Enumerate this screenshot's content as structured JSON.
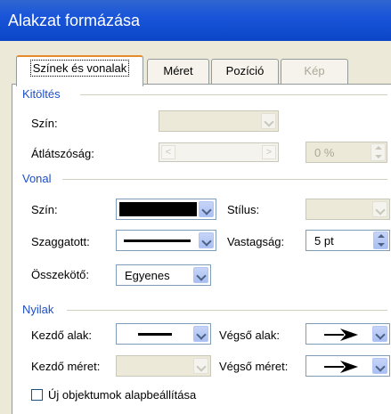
{
  "window": {
    "title": "Alakzat formázása"
  },
  "tabs": [
    {
      "label": "Színek és vonalak",
      "state": "active"
    },
    {
      "label": "Méret",
      "state": "normal"
    },
    {
      "label": "Pozíció",
      "state": "normal"
    },
    {
      "label": "Kép",
      "state": "disabled"
    }
  ],
  "fill": {
    "section_label": "Kitöltés",
    "color_label": "Szín:",
    "transparency_label": "Átlátszóság:",
    "transparency_value": "0 %"
  },
  "line": {
    "section_label": "Vonal",
    "color_label": "Szín:",
    "style_label": "Stílus:",
    "dash_label": "Szaggatott:",
    "weight_label": "Vastagság:",
    "weight_value": "5 pt",
    "connector_label": "Összekötő:",
    "connector_value": "Egyenes"
  },
  "arrows": {
    "section_label": "Nyilak",
    "begin_style_label": "Kezdő alak:",
    "end_style_label": "Végső alak:",
    "begin_size_label": "Kezdő méret:",
    "end_size_label": "Végső méret:"
  },
  "defaults": {
    "checkbox_label": "Új objektumok alapbeállítása",
    "checked": false
  },
  "colors": {
    "titlebar": "#1A55D9",
    "section_text": "#1E4FC8",
    "line_color": "#000000"
  }
}
